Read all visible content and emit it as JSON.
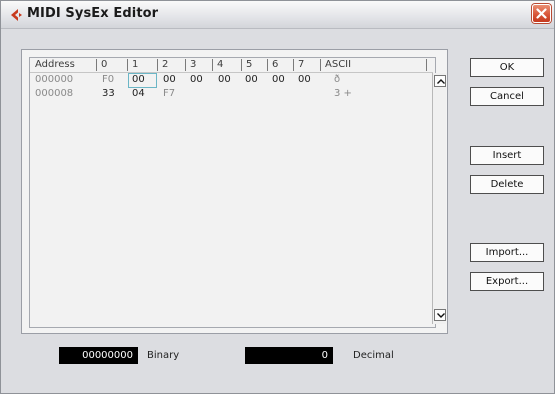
{
  "window": {
    "title": "MIDI SysEx Editor",
    "accent_color": "#c83a1e"
  },
  "grid": {
    "headers": [
      "Address",
      "0",
      "1",
      "2",
      "3",
      "4",
      "5",
      "6",
      "7",
      "ASCII"
    ],
    "rows": [
      {
        "address": "000000",
        "bytes": [
          "F0",
          "00",
          "00",
          "00",
          "00",
          "00",
          "00",
          "00"
        ],
        "ascii": "ð"
      },
      {
        "address": "000008",
        "bytes": [
          "33",
          "04",
          "F7",
          "",
          "",
          "",
          "",
          ""
        ],
        "ascii": "3 +"
      }
    ],
    "selected_cell": {
      "row": 0,
      "col": 1
    }
  },
  "buttons": {
    "ok": "OK",
    "cancel": "Cancel",
    "insert": "Insert",
    "delete": "Delete",
    "import": "Import...",
    "export": "Export..."
  },
  "readouts": {
    "binary_value": "00000000",
    "binary_label": "Binary",
    "decimal_value": "0",
    "decimal_label": "Decimal"
  }
}
